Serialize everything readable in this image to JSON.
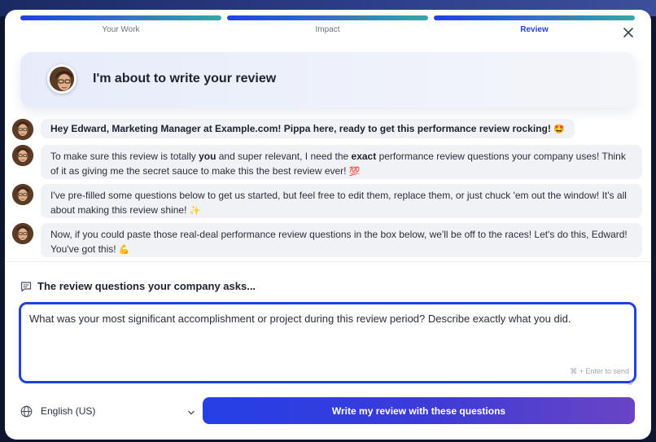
{
  "steps": [
    {
      "label": "Your Work",
      "active": false
    },
    {
      "label": "Impact",
      "active": false
    },
    {
      "label": "Review",
      "active": true
    }
  ],
  "hero": {
    "title": "I'm about to write your review"
  },
  "messages": [
    {
      "line1": "Hey Edward, Marketing Manager at Example.com! Pippa here, ready to get this performance review rocking!",
      "emoji1": "🤩"
    },
    {
      "p1": "To make sure this review is totally ",
      "b1": "you",
      "p2": " and super relevant, I need the ",
      "b2": "exact",
      "p3": " performance review questions your company uses! Think of it as giving me the secret sauce to make this the best review ever!",
      "emoji": "💯"
    },
    {
      "text": "I've pre-filled some questions below to get us started, but feel free to edit them, replace them, or just chuck 'em out the window! It's all about making this review shine!",
      "emoji": "✨"
    },
    {
      "text": "Now, if you could paste those real-deal performance review questions in the box below, we'll be off to the races! Let's do this, Edward! You've got this!",
      "emoji": "💪"
    }
  ],
  "questions": {
    "heading": "The review questions your company asks...",
    "value": "What was your most significant accomplishment or project during this review period? Describe exactly what you did.",
    "hint": "⌘ + Enter to send"
  },
  "footer": {
    "language": "English (US)",
    "submit_label": "Write my review with these questions"
  },
  "colors": {
    "accent": "#2440e0",
    "progress_end": "#3aa6a6",
    "bubble_bg": "#f1f2f5",
    "button_end": "#6a44c4"
  },
  "icons": [
    "close-icon",
    "chat-icon",
    "globe-icon",
    "chevron-down-icon",
    "avatar"
  ]
}
